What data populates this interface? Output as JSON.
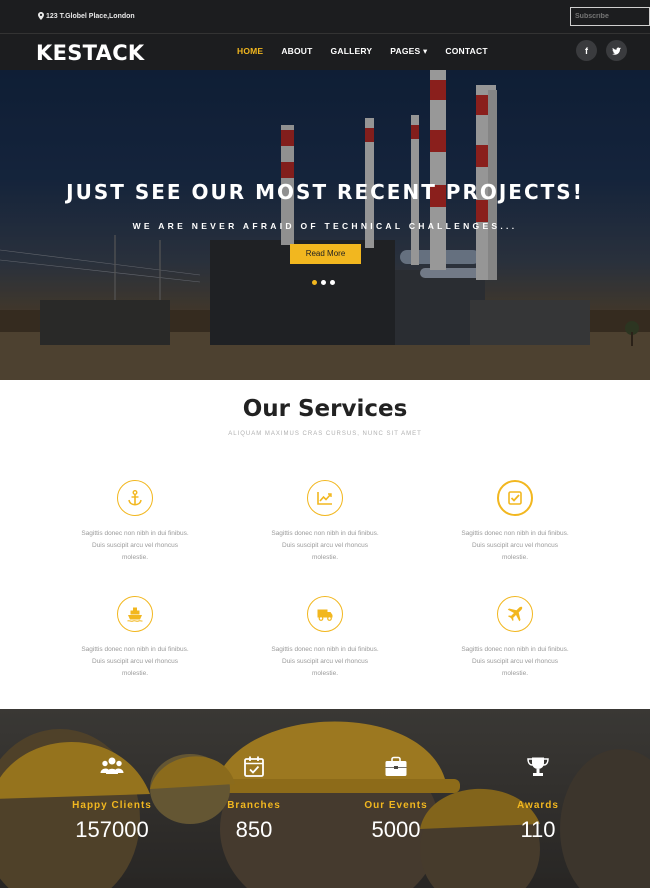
{
  "topbar": {
    "address": "123 T.Globel Place,London",
    "subscribe_placeholder": "Subscribe"
  },
  "nav": {
    "logo": "KESTACK",
    "items": [
      {
        "label": "HOME",
        "active": true
      },
      {
        "label": "ABOUT",
        "active": false
      },
      {
        "label": "GALLERY",
        "active": false
      },
      {
        "label": "PAGES ▾",
        "active": false
      },
      {
        "label": "CONTACT",
        "active": false
      }
    ],
    "social": [
      {
        "icon": "facebook-icon",
        "glyph": "f"
      },
      {
        "icon": "twitter-icon",
        "glyph": "t"
      }
    ]
  },
  "hero": {
    "title": "JUST SEE OUR MOST RECENT PROJECTS!",
    "subtitle": "WE ARE NEVER AFRAID OF TECHNICAL CHALLENGES...",
    "button": "Read More",
    "slides": 3,
    "active_slide": 1
  },
  "services": {
    "title": "Our Services",
    "subtitle": "ALIQUAM MAXIMUS CRAS CURSUS, NUNC SIT AMET",
    "items": [
      {
        "icon": "anchor-icon",
        "line1": "Sagittis donec non nibh in dui finibus.",
        "line2": "Duis suscipit arcu vel rhoncus",
        "line3": "molestie."
      },
      {
        "icon": "chart-icon",
        "line1": "Sagittis donec non nibh in dui finibus.",
        "line2": "Duis suscipit arcu vel rhoncus",
        "line3": "molestie."
      },
      {
        "icon": "checkbox-icon",
        "line1": "Sagittis donec non nibh in dui finibus.",
        "line2": "Duis suscipit arcu vel rhoncus",
        "line3": "molestie."
      },
      {
        "icon": "ship-icon",
        "line1": "Sagittis donec non nibh in dui finibus.",
        "line2": "Duis suscipit arcu vel rhoncus",
        "line3": "molestie."
      },
      {
        "icon": "truck-icon",
        "line1": "Sagittis donec non nibh in dui finibus.",
        "line2": "Duis suscipit arcu vel rhoncus",
        "line3": "molestie."
      },
      {
        "icon": "plane-icon",
        "line1": "Sagittis donec non nibh in dui finibus.",
        "line2": "Duis suscipit arcu vel rhoncus",
        "line3": "molestie."
      }
    ]
  },
  "counters": [
    {
      "icon": "users-icon",
      "label": "Happy Clients",
      "value": "157000"
    },
    {
      "icon": "calendar-check-icon",
      "label": "Branches",
      "value": "850"
    },
    {
      "icon": "briefcase-icon",
      "label": "Our Events",
      "value": "5000"
    },
    {
      "icon": "trophy-icon",
      "label": "Awards",
      "value": "110"
    }
  ],
  "colors": {
    "accent": "#f2b71f",
    "dark": "#1c1d1f"
  }
}
